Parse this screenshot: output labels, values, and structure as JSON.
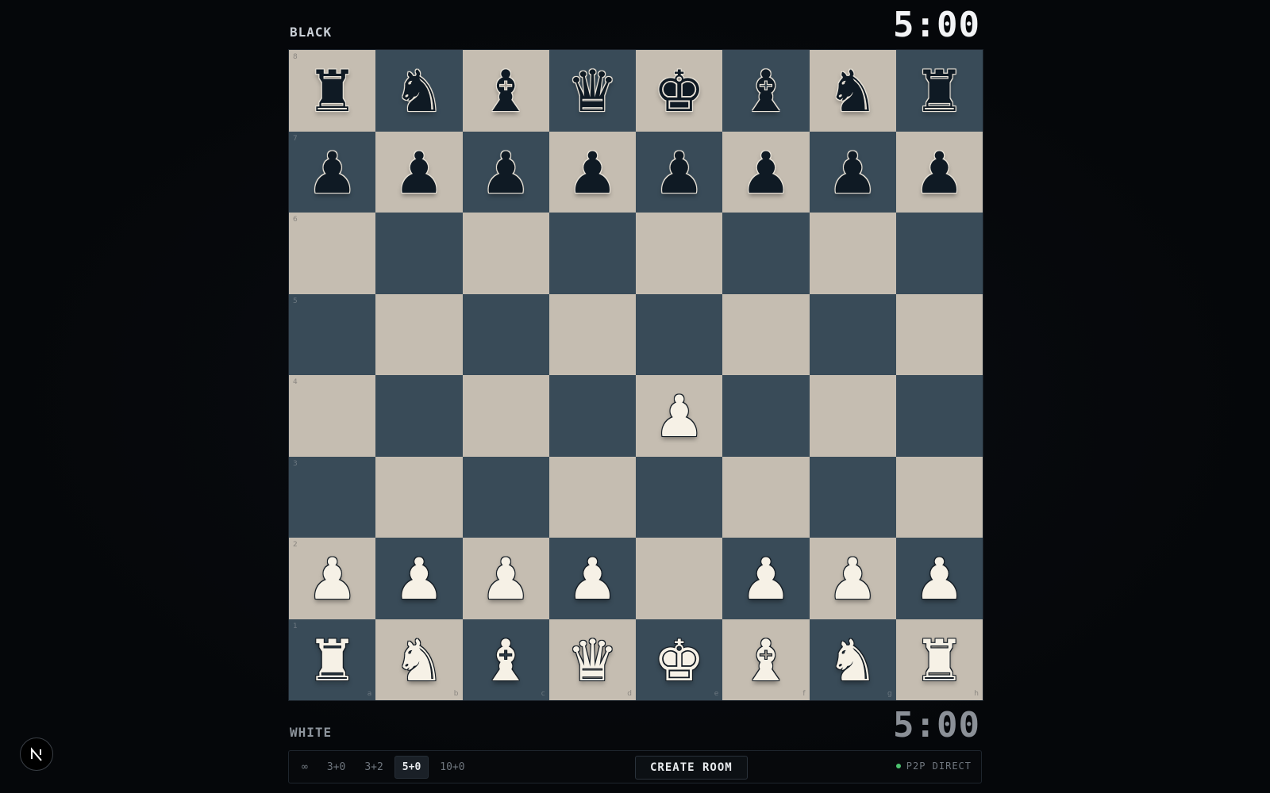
{
  "players": {
    "top": {
      "name": "BLACK",
      "clock": "5:00"
    },
    "bottom": {
      "name": "WHITE",
      "clock": "5:00"
    }
  },
  "board": {
    "orientation": "white-bottom",
    "files": [
      "a",
      "b",
      "c",
      "d",
      "e",
      "f",
      "g",
      "h"
    ],
    "ranks": [
      "8",
      "7",
      "6",
      "5",
      "4",
      "3",
      "2",
      "1"
    ],
    "colors": {
      "light": "#c5bdb1",
      "dark": "#394b58"
    },
    "position": [
      [
        "br",
        "bn",
        "bb",
        "bq",
        "bk",
        "bb",
        "bn",
        "br"
      ],
      [
        "bp",
        "bp",
        "bp",
        "bp",
        "bp",
        "bp",
        "bp",
        "bp"
      ],
      [
        "",
        "",
        "",
        "",
        "",
        "",
        "",
        ""
      ],
      [
        "",
        "",
        "",
        "",
        "",
        "",
        "",
        ""
      ],
      [
        "",
        "",
        "",
        "",
        "wp",
        "",
        "",
        ""
      ],
      [
        "",
        "",
        "",
        "",
        "",
        "",
        "",
        ""
      ],
      [
        "wp",
        "wp",
        "wp",
        "wp",
        "",
        "wp",
        "wp",
        "wp"
      ],
      [
        "wr",
        "wn",
        "wb",
        "wq",
        "wk",
        "wb",
        "wn",
        "wr"
      ]
    ]
  },
  "controls": {
    "time_controls": [
      "∞",
      "3+0",
      "3+2",
      "5+0",
      "10+0"
    ],
    "selected_time_control": "5+0",
    "create_room_label": "CREATE ROOM",
    "status_label": "P2P DIRECT",
    "status_color": "#4cc36f"
  },
  "devtools": {
    "icon": "nextjs-logo-icon"
  }
}
